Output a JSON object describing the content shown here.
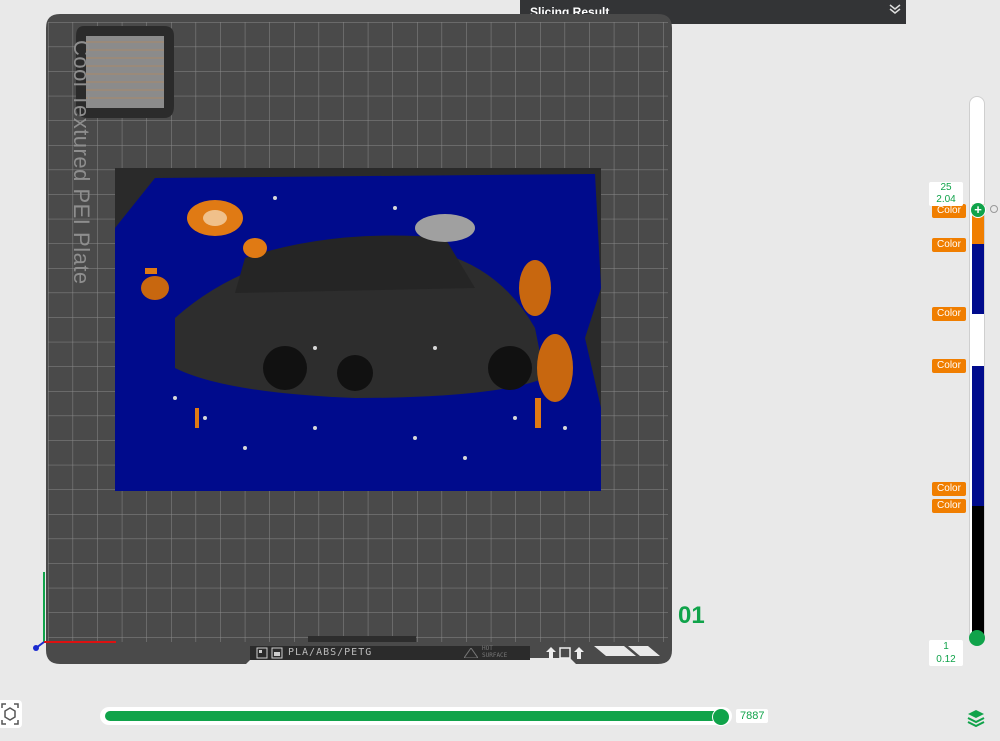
{
  "slicing_panel": {
    "title": "Slicing Result",
    "chevron_icon": "double-chevron-down-icon"
  },
  "plate": {
    "label": "Cool Textured PEI Plate",
    "number": "01",
    "material": "PLA/ABS/PETG",
    "hot_surface": [
      "HOT",
      "SURFACE"
    ]
  },
  "layer_slider": {
    "top_layer": "25",
    "top_height": "2.04",
    "bottom_layer": "1",
    "bottom_height": "0.12",
    "color_tags": [
      "Color",
      "Color",
      "Color",
      "Color",
      "Color",
      "Color"
    ],
    "colors": {
      "orange": "#f07e00",
      "blue": "#000b8c",
      "white": "#ffffff",
      "black": "#000000"
    }
  },
  "move_slider": {
    "value": "7887",
    "fraction": 1.0
  },
  "colors": {
    "accent": "#10a34a",
    "plate": "#4a4a4a",
    "panel": "#333436"
  },
  "icons": {
    "reset_view": "reset-view-icon",
    "layers": "layers-icon"
  }
}
